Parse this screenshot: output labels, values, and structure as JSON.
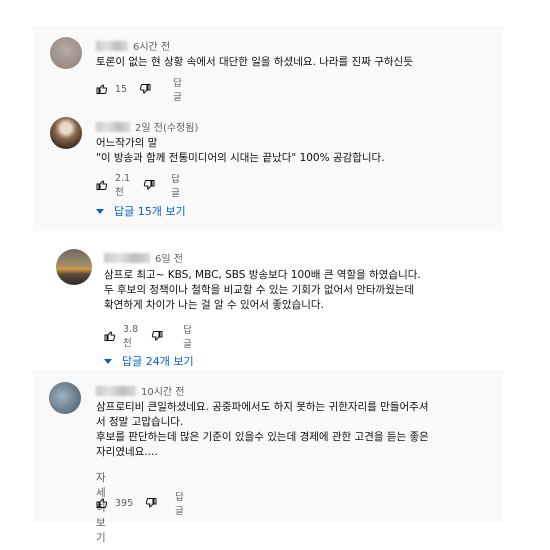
{
  "comments": [
    {
      "time": "6시간 전",
      "lines": [
        "토론이 없는 현 상황 속에서 대단한 일을 하셨네요. 나라를 진짜 구하신듯"
      ],
      "likes": "15",
      "reply_label": "답글"
    },
    {
      "time": "2일 전(수정됨)",
      "lines": [
        "어느작가의 말",
        "\"이 방송과 함께 전통미디어의 시대는 끝났다\" 100% 공감합니다."
      ],
      "likes": "2.1천",
      "reply_label": "답글",
      "view_replies": "답글 15개 보기"
    },
    {
      "time": "6일 전",
      "lines": [
        "삼프로 최고~ KBS, MBC, SBS 방송보다 100배 큰 역할을 하였습니다.",
        "두 후보의 정책이나 철학을 비교할 수 있는 기회가 없어서 안타까웠는데",
        "확연하게 차이가 나는 걸 알 수 있어서 좋았습니다."
      ],
      "likes": "3.8천",
      "reply_label": "답글",
      "view_replies": "답글 24개 보기"
    },
    {
      "time": "10시간 전",
      "lines": [
        "삼프로티비 큰일하셨네요. 공중파에서도 하지 못하는 귀한자리를 만들어주셔",
        "서 정말 고맙습니다.",
        "후보를 판단하는데 많은 기준이 있을수 있는데 경제에 관한 고견을 듣는 좋은",
        "자리였네요...."
      ],
      "more_label": "자세히 보기",
      "likes": "395",
      "reply_label": "답글"
    }
  ],
  "colors": {
    "link": "#065fd4",
    "meta": "#606060",
    "panel": "#f9f9f9"
  }
}
